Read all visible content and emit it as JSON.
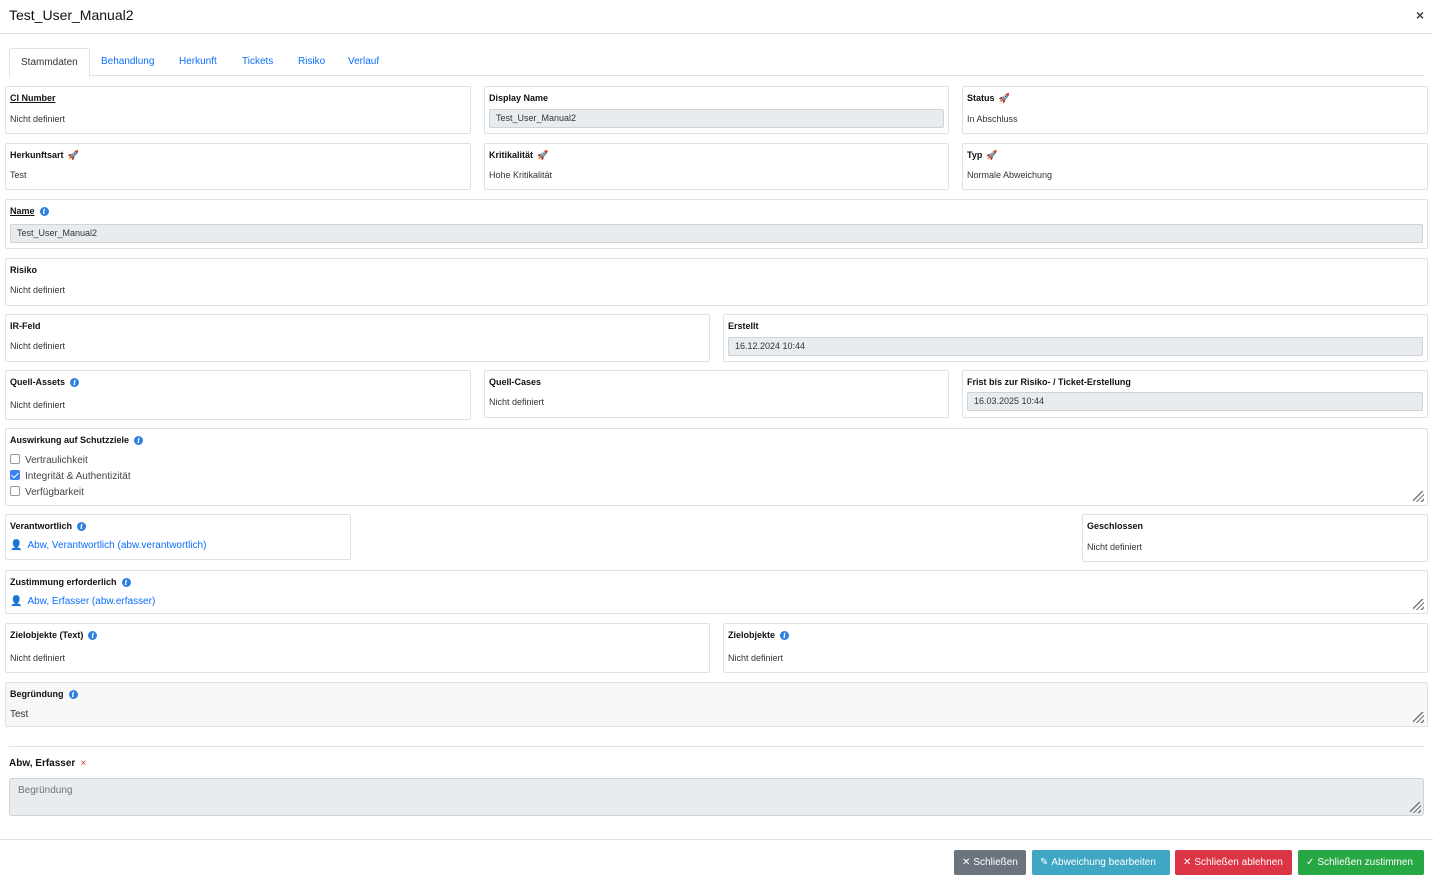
{
  "modal": {
    "title": "Test_User_Manual2",
    "close": "×"
  },
  "tabs": [
    {
      "label": "Stammdaten"
    },
    {
      "label": "Behandlung"
    },
    {
      "label": "Herkunft"
    },
    {
      "label": "Tickets"
    },
    {
      "label": "Risiko"
    },
    {
      "label": "Verlauf"
    }
  ],
  "fields": {
    "ci_number": {
      "label": "CI Number",
      "value": "Nicht definiert"
    },
    "display_name": {
      "label": "Display Name",
      "value": "Test_User_Manual2"
    },
    "status": {
      "label": "Status",
      "value": "In Abschluss"
    },
    "herkunftsart": {
      "label": "Herkunftsart",
      "value": "Test"
    },
    "kritikalitaet": {
      "label": "Kritikalität",
      "value": "Hohe Kritikalität"
    },
    "typ": {
      "label": "Typ",
      "value": "Normale Abweichung"
    },
    "name": {
      "label": "Name",
      "value": "Test_User_Manual2"
    },
    "risiko": {
      "label": "Risiko",
      "value": "Nicht definiert"
    },
    "ir_feld": {
      "label": "IR-Feld",
      "value": "Nicht definiert"
    },
    "erstellt": {
      "label": "Erstellt",
      "value": "16.12.2024 10:44"
    },
    "quell_assets": {
      "label": "Quell-Assets",
      "value": "Nicht definiert"
    },
    "quell_cases": {
      "label": "Quell-Cases",
      "value": "Nicht definiert"
    },
    "frist": {
      "label": "Frist bis zur Risiko- / Ticket-Erstellung",
      "value": "16.03.2025 10:44"
    },
    "schutzziele": {
      "label": "Auswirkung auf Schutzziele",
      "options": [
        {
          "label": "Vertraulichkeit",
          "checked": false
        },
        {
          "label": "Integrität & Authentizität",
          "checked": true
        },
        {
          "label": "Verfügbarkeit",
          "checked": false
        }
      ]
    },
    "verantwortlich": {
      "label": "Verantwortlich",
      "value": "Abw, Verantwortlich (abw.verantwortlich)"
    },
    "geschlossen": {
      "label": "Geschlossen",
      "value": "Nicht definiert"
    },
    "zustimmung": {
      "label": "Zustimmung erforderlich",
      "value": "Abw, Erfasser (abw.erfasser)"
    },
    "zielobjekte_text": {
      "label": "Zielobjekte (Text)",
      "value": "Nicht definiert"
    },
    "zielobjekte": {
      "label": "Zielobjekte",
      "value": "Nicht definiert"
    },
    "begruendung": {
      "label": "Begründung",
      "value": "Test"
    }
  },
  "approval": {
    "approver": "Abw, Erfasser",
    "remove": "×",
    "textarea_placeholder": "Begründung"
  },
  "buttons": {
    "close": "Schließen",
    "edit": "Abweichung bearbeiten",
    "reject": "Schließen ablehnen",
    "approve": "Schließen zustimmen"
  },
  "icons": {
    "info": "info-icon",
    "rocket": "rocket-icon",
    "user": "user-icon"
  },
  "colors": {
    "link": "#0d6efd",
    "btn_close": "#6c757d",
    "btn_edit": "#3fa7c4",
    "btn_reject": "#dc3545",
    "btn_approve": "#28a745"
  }
}
